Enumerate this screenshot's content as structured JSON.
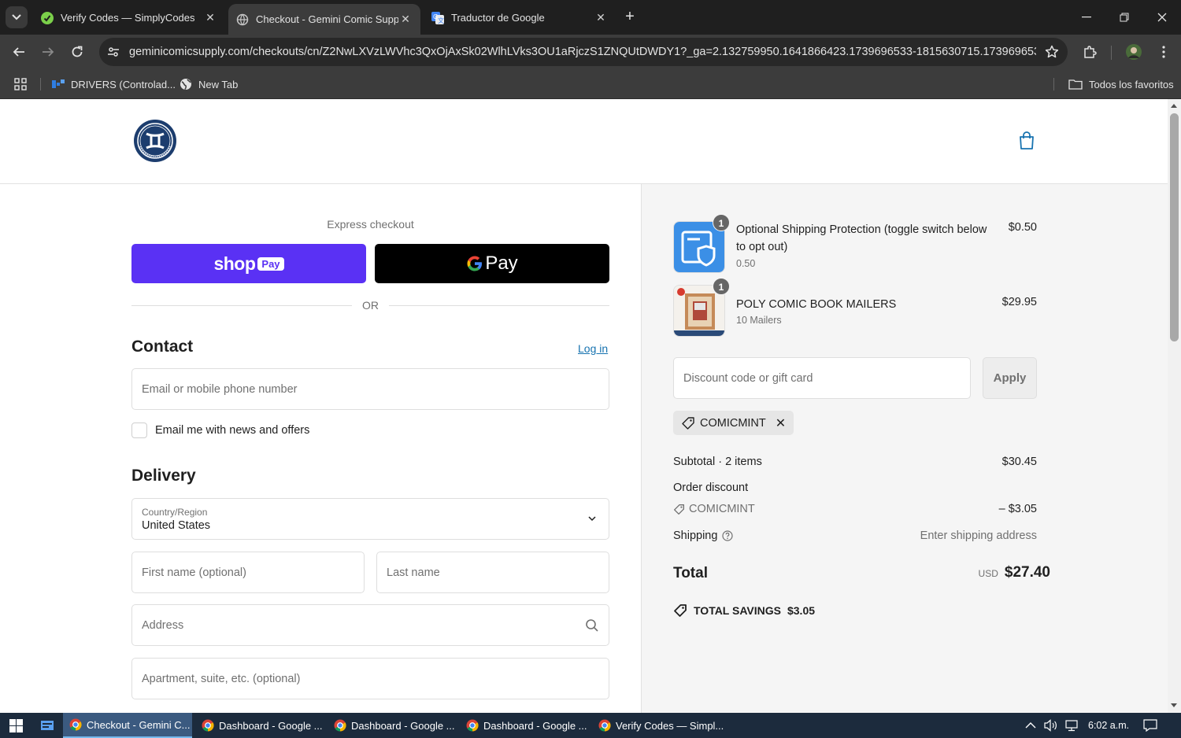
{
  "browser": {
    "tabs": [
      {
        "title": "Verify Codes — SimplyCodes",
        "active": false
      },
      {
        "title": "Checkout - Gemini Comic Supp",
        "active": true
      },
      {
        "title": "Traductor de Google",
        "active": false
      }
    ],
    "url": "geminicomicsupply.com/checkouts/cn/Z2NwLXVzLWVhc3QxOjAxSk02WlhLVks3OU1aRjczS1ZNQUtDWDY1?_ga=2.132759950.1641866423.1739696533-1815630715.173969653...",
    "bookmarks": [
      {
        "label": "DRIVERS (Controlad..."
      },
      {
        "label": "New Tab"
      }
    ],
    "all_bookmarks": "Todos los favoritos"
  },
  "checkout": {
    "express_label": "Express checkout",
    "shop_pay": {
      "word": "shop",
      "pay": "Pay"
    },
    "gpay": {
      "g": "G",
      "pay": "Pay"
    },
    "or": "OR",
    "contact": {
      "title": "Contact",
      "login": "Log in",
      "email_placeholder": "Email or mobile phone number",
      "newsletter": "Email me with news and offers"
    },
    "delivery": {
      "title": "Delivery",
      "country_label": "Country/Region",
      "country_value": "United States",
      "first_name_placeholder": "First name (optional)",
      "last_name_placeholder": "Last name",
      "address_placeholder": "Address",
      "apartment_placeholder": "Apartment, suite, etc. (optional)"
    }
  },
  "summary": {
    "items": [
      {
        "name": "Optional Shipping Protection (toggle switch below to opt out)",
        "sub": "0.50",
        "price": "$0.50",
        "qty": "1"
      },
      {
        "name": "POLY COMIC BOOK MAILERS",
        "sub": "10 Mailers",
        "price": "$29.95",
        "qty": "1"
      }
    ],
    "discount_placeholder": "Discount code or gift card",
    "apply": "Apply",
    "applied_code": "COMICMINT",
    "subtotal_label": "Subtotal · 2 items",
    "subtotal_value": "$30.45",
    "order_discount_label": "Order discount",
    "discount_code": "COMICMINT",
    "discount_value": "– $3.05",
    "shipping_label": "Shipping",
    "shipping_value": "Enter shipping address",
    "total_label": "Total",
    "currency": "USD",
    "total_value": "$27.40",
    "savings_label": "TOTAL SAVINGS",
    "savings_value": "$3.05"
  },
  "taskbar": {
    "apps": [
      {
        "label": "Checkout - Gemini C...",
        "active": true
      },
      {
        "label": "Dashboard - Google ...",
        "active": false
      },
      {
        "label": "Dashboard - Google ...",
        "active": false
      },
      {
        "label": "Dashboard - Google ...",
        "active": false
      },
      {
        "label": "Verify Codes — Simpl...",
        "active": false
      }
    ],
    "clock": "6:02 a.m."
  },
  "colors": {
    "shop_pay": "#5a31f4",
    "link": "#1773b0",
    "logo_navy": "#1c3d6e",
    "shield_blue": "#3b8fe6"
  }
}
